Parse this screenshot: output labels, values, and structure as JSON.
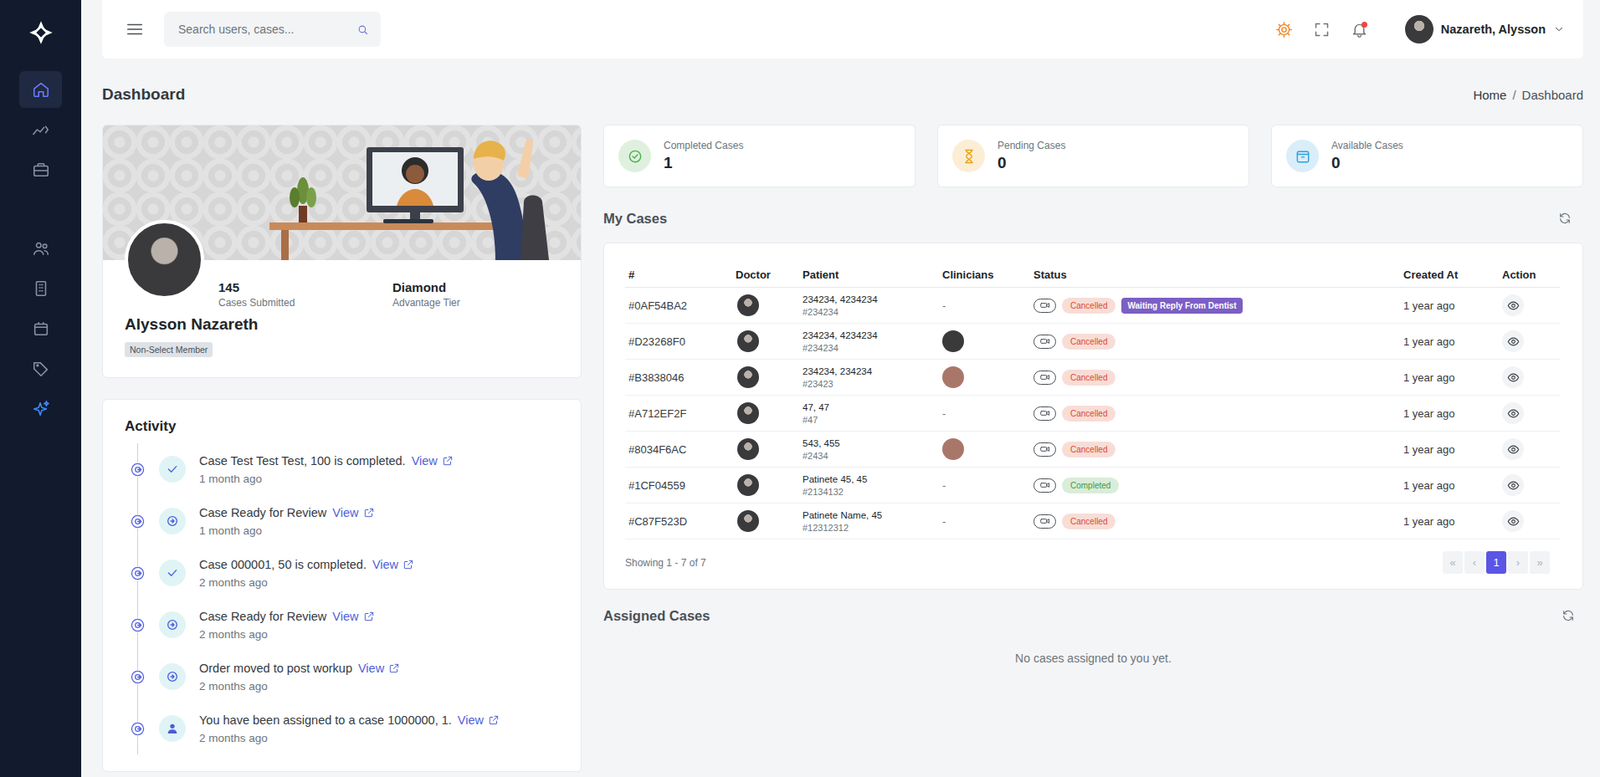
{
  "header": {
    "search_placeholder": "Search users, cases...",
    "user_name": "Nazareth, Alysson",
    "notification_dot": true
  },
  "sidebar": {
    "groups": [
      [
        {
          "kind": "home",
          "selected": true
        },
        {
          "kind": "analytics",
          "selected": false
        },
        {
          "kind": "briefcase",
          "selected": false
        }
      ],
      [
        {
          "kind": "users",
          "selected": false
        },
        {
          "kind": "building",
          "selected": false
        },
        {
          "kind": "calendar",
          "selected": false
        },
        {
          "kind": "tags",
          "selected": false
        },
        {
          "kind": "sparkles",
          "selected": false
        }
      ]
    ]
  },
  "page": {
    "title": "Dashboard",
    "breadcrumb": {
      "items": [
        "Home",
        "Dashboard"
      ],
      "separator": "/"
    }
  },
  "profile": {
    "name": "Alysson Nazareth",
    "badge": "Non-Select Member",
    "stats": [
      {
        "value": "145",
        "label": "Cases Submitted"
      },
      {
        "value": "Diamond",
        "label": "Advantage Tier"
      }
    ]
  },
  "activity": {
    "title": "Activity",
    "items": [
      {
        "kind": "completed",
        "text": "Case Test Test Test, 100 is completed.",
        "link": "View",
        "time": "1 month ago"
      },
      {
        "kind": "review",
        "text": "Case Ready for Review",
        "link": "View",
        "time": "1 month ago"
      },
      {
        "kind": "completed",
        "text": "Case 000001, 50 is completed.",
        "link": "View",
        "time": "2 months ago"
      },
      {
        "kind": "review",
        "text": "Case Ready for Review",
        "link": "View",
        "time": "2 months ago"
      },
      {
        "kind": "review",
        "text": "Order moved to post workup",
        "link": "View",
        "time": "2 months ago"
      },
      {
        "kind": "assigned",
        "text": "You have been assigned to a case 1000000, 1.",
        "link": "View",
        "time": "2 months ago"
      }
    ]
  },
  "stats": [
    {
      "kind": "check",
      "label": "Completed Cases",
      "value": "1",
      "color": "#4fae4f"
    },
    {
      "kind": "hourglass",
      "label": "Pending Cases",
      "value": "0",
      "color": "#e8a317"
    },
    {
      "kind": "box",
      "label": "Available Cases",
      "value": "0",
      "color": "#2f9fdc"
    }
  ],
  "my_cases": {
    "title": "My Cases",
    "columns": [
      "#",
      "Doctor",
      "Patient",
      "Clinicians",
      "Status",
      "Created At",
      "Action"
    ],
    "rows": [
      {
        "id": "#0AF54BA2",
        "patient_name": "234234, 4234234",
        "patient_id": "#234234",
        "clinician": {
          "text": "-"
        },
        "status": {
          "label": "Cancelled",
          "color": "#dc4a2c"
        },
        "tags": [
          {
            "label": "Waiting Reply From Dentist",
            "color": "#7b5fc4"
          }
        ],
        "created": "1 year ago"
      },
      {
        "id": "#D23268F0",
        "patient_name": "234234, 4234234",
        "patient_id": "#234234",
        "clinician": {
          "color": "#3a3a3a"
        },
        "status": {
          "label": "Cancelled",
          "color": "#dc4a2c"
        },
        "tags": [],
        "created": "1 year ago"
      },
      {
        "id": "#B3838046",
        "patient_name": "234234, 234234",
        "patient_id": "#23423",
        "clinician": {
          "color": "#a9776a"
        },
        "status": {
          "label": "Cancelled",
          "color": "#dc4a2c"
        },
        "tags": [],
        "created": "1 year ago"
      },
      {
        "id": "#A712EF2F",
        "patient_name": "47, 47",
        "patient_id": "#47",
        "clinician": {
          "text": "-"
        },
        "status": {
          "label": "Cancelled",
          "color": "#dc4a2c"
        },
        "tags": [],
        "created": "1 year ago"
      },
      {
        "id": "#8034F6AC",
        "patient_name": "543, 455",
        "patient_id": "#2434",
        "clinician": {
          "color": "#a9776a"
        },
        "status": {
          "label": "Cancelled",
          "color": "#dc4a2c"
        },
        "tags": [],
        "created": "1 year ago"
      },
      {
        "id": "#1CF04559",
        "patient_name": "Patinete 45, 45",
        "patient_id": "#2134132",
        "clinician": {
          "text": "-"
        },
        "status": {
          "label": "Completed",
          "color": "#3c9c3c"
        },
        "tags": [],
        "created": "1 year ago"
      },
      {
        "id": "#C87F523D",
        "patient_name": "Patinete Name, 45",
        "patient_id": "#12312312",
        "clinician": {
          "text": "-"
        },
        "status": {
          "label": "Cancelled",
          "color": "#dc4a2c"
        },
        "tags": [],
        "created": "1 year ago"
      }
    ],
    "showing": "Showing 1 - 7 of 7",
    "pages": [
      {
        "label": "«",
        "selected": false,
        "disabled": true
      },
      {
        "label": "‹",
        "selected": false,
        "disabled": true
      },
      {
        "label": "1",
        "selected": true,
        "disabled": false
      },
      {
        "label": "›",
        "selected": false,
        "disabled": true
      },
      {
        "label": "»",
        "selected": false,
        "disabled": true
      }
    ]
  },
  "assigned_cases": {
    "title": "Assigned Cases",
    "empty_text": "No cases assigned to you yet."
  }
}
